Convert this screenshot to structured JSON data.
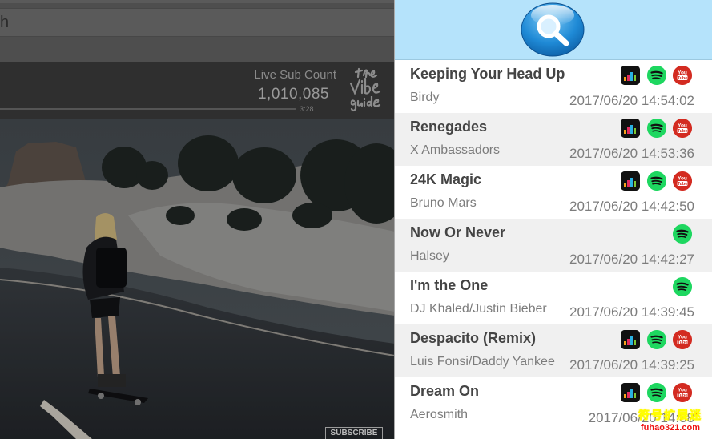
{
  "browser": {
    "search_text": "h"
  },
  "video_overlay": {
    "sub_title": "Live Sub Count",
    "sub_count": "1,010,085",
    "time": "3:28",
    "subscribe_label": "SUBSCRIBE"
  },
  "panel": {
    "header_color": "#b5e3fb",
    "songs": [
      {
        "title": "Keeping Your Head Up",
        "artist": "Birdy",
        "time": "2017/06/20 14:54:02",
        "services": [
          "deezer",
          "spotify",
          "youtube"
        ]
      },
      {
        "title": "Renegades",
        "artist": "X Ambassadors",
        "time": "2017/06/20 14:53:36",
        "services": [
          "deezer",
          "spotify",
          "youtube"
        ]
      },
      {
        "title": "24K Magic",
        "artist": "Bruno Mars",
        "time": "2017/06/20 14:42:50",
        "services": [
          "deezer",
          "spotify",
          "youtube"
        ]
      },
      {
        "title": "Now Or Never",
        "artist": "Halsey",
        "time": "2017/06/20 14:42:27",
        "services": [
          "spotify"
        ]
      },
      {
        "title": "I'm the One",
        "artist": "DJ Khaled/Justin Bieber",
        "time": "2017/06/20 14:39:45",
        "services": [
          "spotify"
        ]
      },
      {
        "title": "Despacito (Remix)",
        "artist": "Luis Fonsi/Daddy Yankee",
        "time": "2017/06/20 14:39:25",
        "services": [
          "deezer",
          "spotify",
          "youtube"
        ]
      },
      {
        "title": "Dream On",
        "artist": "Aerosmith",
        "time": "2017/06/20 14:38",
        "services": [
          "deezer",
          "spotify",
          "youtube"
        ]
      }
    ]
  },
  "watermark": {
    "line1": "符号扩展迷",
    "line2": "fuhao321.com"
  }
}
